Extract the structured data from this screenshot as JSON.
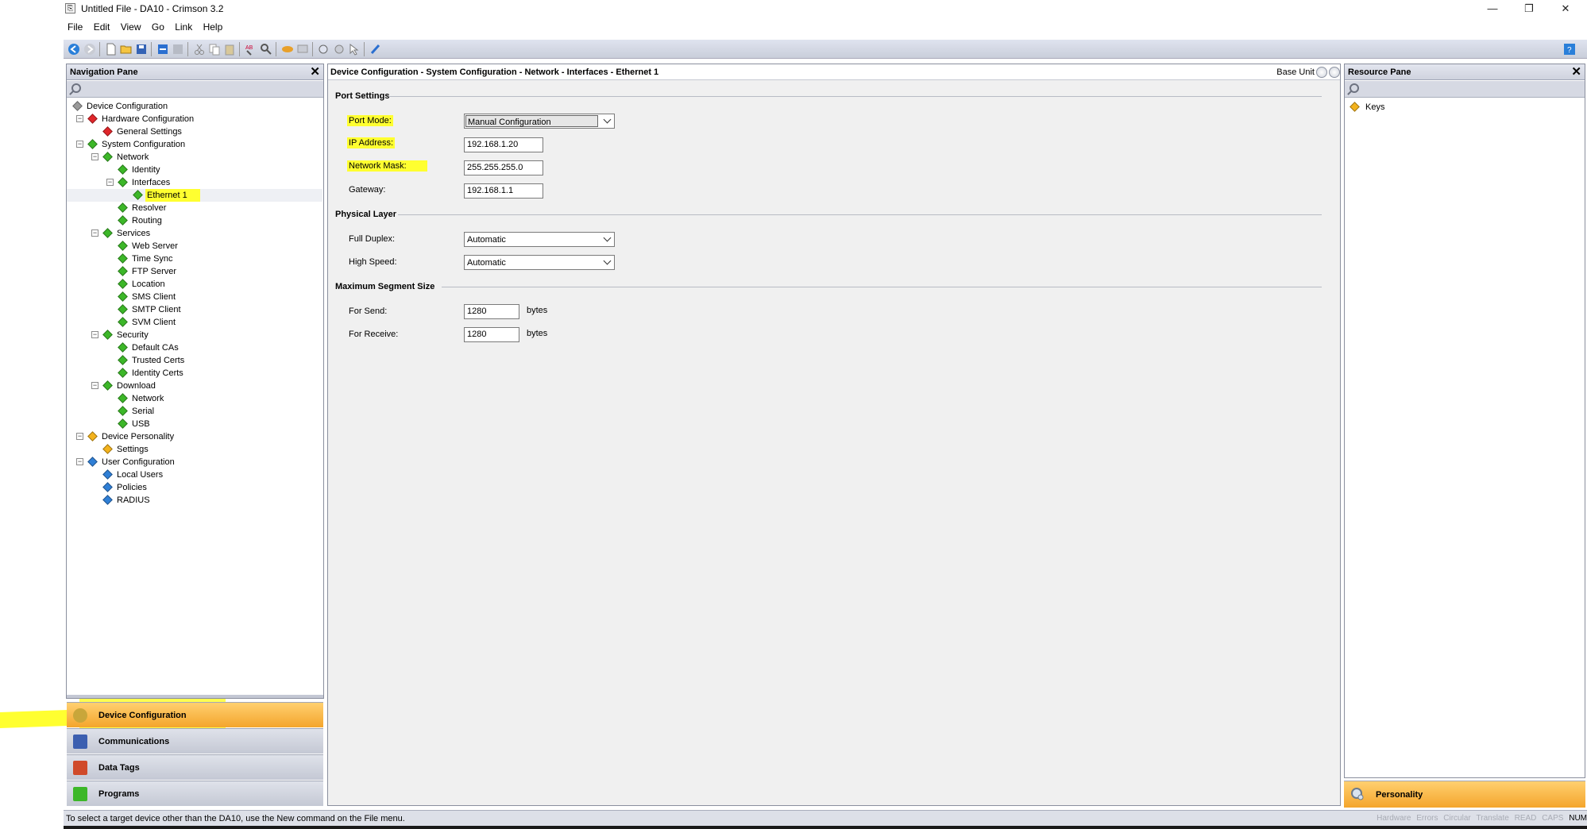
{
  "window": {
    "title": "Untitled File - DA10 - Crimson 3.2",
    "minimize": "—",
    "restore": "❐",
    "close": "✕"
  },
  "menu": [
    "File",
    "Edit",
    "View",
    "Go",
    "Link",
    "Help"
  ],
  "nav_pane": {
    "title": "Navigation Pane",
    "tree": [
      {
        "label": "Device Configuration",
        "color": "#9a9a9a",
        "level": 0,
        "expander": ""
      },
      {
        "label": "Hardware Configuration",
        "color": "#e0262a",
        "level": 1,
        "expander": "−"
      },
      {
        "label": "General Settings",
        "color": "#e0262a",
        "level": 2,
        "expander": ""
      },
      {
        "label": "System Configuration",
        "color": "#3cb728",
        "level": 1,
        "expander": "−"
      },
      {
        "label": "Network",
        "color": "#3cb728",
        "level": 2,
        "expander": "−"
      },
      {
        "label": "Identity",
        "color": "#3cb728",
        "level": 3,
        "expander": ""
      },
      {
        "label": "Interfaces",
        "color": "#3cb728",
        "level": 3,
        "expander": "−"
      },
      {
        "label": "Ethernet 1",
        "color": "#3cb728",
        "level": 4,
        "expander": "",
        "selected": true
      },
      {
        "label": "Resolver",
        "color": "#3cb728",
        "level": 3,
        "expander": ""
      },
      {
        "label": "Routing",
        "color": "#3cb728",
        "level": 3,
        "expander": ""
      },
      {
        "label": "Services",
        "color": "#3cb728",
        "level": 2,
        "expander": "−"
      },
      {
        "label": "Web Server",
        "color": "#3cb728",
        "level": 3,
        "expander": ""
      },
      {
        "label": "Time Sync",
        "color": "#3cb728",
        "level": 3,
        "expander": ""
      },
      {
        "label": "FTP Server",
        "color": "#3cb728",
        "level": 3,
        "expander": ""
      },
      {
        "label": "Location",
        "color": "#3cb728",
        "level": 3,
        "expander": ""
      },
      {
        "label": "SMS Client",
        "color": "#3cb728",
        "level": 3,
        "expander": ""
      },
      {
        "label": "SMTP Client",
        "color": "#3cb728",
        "level": 3,
        "expander": ""
      },
      {
        "label": "SVM Client",
        "color": "#3cb728",
        "level": 3,
        "expander": ""
      },
      {
        "label": "Security",
        "color": "#3cb728",
        "level": 2,
        "expander": "−"
      },
      {
        "label": "Default CAs",
        "color": "#3cb728",
        "level": 3,
        "expander": ""
      },
      {
        "label": "Trusted Certs",
        "color": "#3cb728",
        "level": 3,
        "expander": ""
      },
      {
        "label": "Identity Certs",
        "color": "#3cb728",
        "level": 3,
        "expander": ""
      },
      {
        "label": "Download",
        "color": "#3cb728",
        "level": 2,
        "expander": "−"
      },
      {
        "label": "Network",
        "color": "#3cb728",
        "level": 3,
        "expander": ""
      },
      {
        "label": "Serial",
        "color": "#3cb728",
        "level": 3,
        "expander": ""
      },
      {
        "label": "USB",
        "color": "#3cb728",
        "level": 3,
        "expander": ""
      },
      {
        "label": "Device Personality",
        "color": "#f3b21c",
        "level": 1,
        "expander": "−"
      },
      {
        "label": "Settings",
        "color": "#f3b21c",
        "level": 2,
        "expander": ""
      },
      {
        "label": "User Configuration",
        "color": "#2f7fd6",
        "level": 1,
        "expander": "−"
      },
      {
        "label": "Local Users",
        "color": "#2f7fd6",
        "level": 2,
        "expander": ""
      },
      {
        "label": "Policies",
        "color": "#2f7fd6",
        "level": 2,
        "expander": ""
      },
      {
        "label": "RADIUS",
        "color": "#2f7fd6",
        "level": 2,
        "expander": ""
      }
    ],
    "buttons": [
      {
        "label": "Device Configuration",
        "active": true
      },
      {
        "label": "Communications",
        "active": false
      },
      {
        "label": "Data Tags",
        "active": false
      },
      {
        "label": "Programs",
        "active": false
      }
    ]
  },
  "main": {
    "breadcrumb": "Device Configuration - System Configuration - Network - Interfaces - Ethernet 1",
    "base_unit": "Base Unit",
    "sections": {
      "port_settings": "Port Settings",
      "physical_layer": "Physical Layer",
      "max_segment": "Maximum Segment Size"
    },
    "fields": {
      "port_mode_label": "Port Mode:",
      "port_mode_value": "Manual Configuration",
      "ip_label": "IP Address:",
      "ip_value": "192.168.1.20",
      "mask_label": "Network Mask:",
      "mask_value": "255.255.255.0",
      "gateway_label": "Gateway:",
      "gateway_value": "192.168.1.1",
      "duplex_label": "Full Duplex:",
      "duplex_value": "Automatic",
      "speed_label": "High Speed:",
      "speed_value": "Automatic",
      "send_label": "For Send:",
      "send_value": "1280",
      "send_unit": "bytes",
      "receive_label": "For Receive:",
      "receive_value": "1280",
      "receive_unit": "bytes"
    }
  },
  "resource_pane": {
    "title": "Resource Pane",
    "item": "Keys",
    "button": "Personality"
  },
  "status": {
    "message": "To select a target device other than the DA10, use the New command on the File menu.",
    "indicators": [
      "Hardware",
      "Errors",
      "Circular",
      "Translate",
      "READ",
      "CAPS",
      "NUM"
    ]
  },
  "colors": {
    "highlight": "#ffff30",
    "active_button": "#f4a52c"
  }
}
